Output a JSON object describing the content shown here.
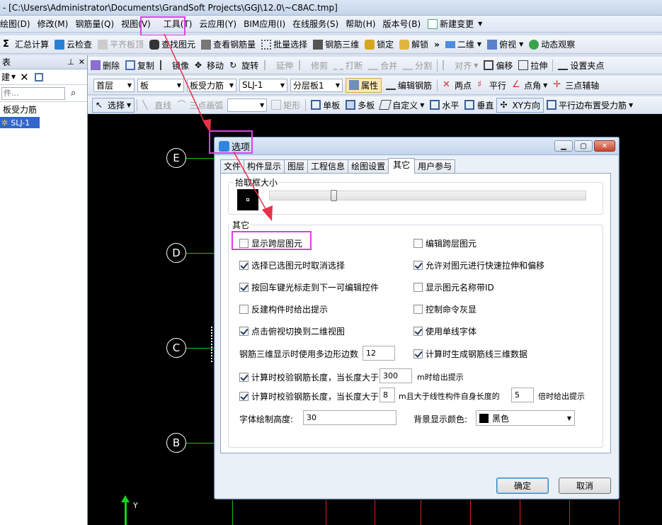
{
  "window": {
    "title": "- [C:\\Users\\Administrator\\Documents\\GrandSoft Projects\\GGJ\\12.0\\~C8AC.tmp]"
  },
  "menu": [
    "绘图(D)",
    "修改(M)",
    "钢筋量(Q)",
    "视图(V)",
    "工具(T)",
    "云应用(Y)",
    "BIM应用(I)",
    "在线服务(S)",
    "帮助(H)",
    "版本号(B)",
    "新建变更"
  ],
  "toolbar1": {
    "items": [
      "汇总计算",
      "云检查",
      "平齐板顶",
      "查找图元",
      "查看钢筋量",
      "批量选择",
      "钢筋三维",
      "锁定",
      "解锁"
    ],
    "view_combo": "二维",
    "view_mode": "俯视",
    "dynamic": "动态观察"
  },
  "toolbar2": {
    "items": [
      "删除",
      "复制",
      "镜像",
      "移动",
      "旋转",
      "延伸",
      "修剪",
      "打断",
      "合并",
      "分割",
      "对齐",
      "偏移",
      "拉伸",
      "设置夹点"
    ]
  },
  "toolbar3": {
    "floor": "首层",
    "category": "板",
    "type": "板受力筋",
    "item": "SLJ-1",
    "layer": "分层板1",
    "props": "属性",
    "edit": "编辑钢筋",
    "pick": [
      "两点",
      "平行",
      "点角",
      "三点辅轴"
    ]
  },
  "toolbar4": {
    "items": [
      "选择",
      "直线",
      "三点画弧",
      "矩形",
      "单板",
      "多板",
      "自定义",
      "水平",
      "垂直",
      "XY方向",
      "平行边布置受力筋"
    ]
  },
  "left_panel": {
    "header": "表",
    "tool": "建",
    "search_placeholder": "件...",
    "tree_parent": "板受力筋",
    "tree_child": "SLJ-1"
  },
  "canvas": {
    "axes": [
      "E",
      "D",
      "C",
      "B"
    ],
    "y_label": "Y"
  },
  "dialog": {
    "title": "选项",
    "tabs": [
      "文件",
      "构件显示",
      "图层",
      "工程信息",
      "绘图设置",
      "其它",
      "用户参与"
    ],
    "active_tab": "其它",
    "pickbox_label": "拾取框大小",
    "other_label": "其它",
    "options": [
      {
        "label": "显示跨层图元",
        "checked": false
      },
      {
        "label": "编辑跨层图元",
        "checked": false
      },
      {
        "label": "选择已选图元时取消选择",
        "checked": true
      },
      {
        "label": "允许对图元进行快速拉伸和偏移",
        "checked": true
      },
      {
        "label": "按回车键光标走到下一可编辑控件",
        "checked": true
      },
      {
        "label": "显示图元名称带ID",
        "checked": false
      },
      {
        "label": "反建构件时给出提示",
        "checked": false
      },
      {
        "label": "控制命令灰显",
        "checked": false
      },
      {
        "label": "点击俯视切换到二维视图",
        "checked": true
      },
      {
        "label": "使用单线字体",
        "checked": true
      }
    ],
    "polygon_label": "钢筋三维显示时使用多边形边数",
    "polygon_value": "12",
    "gen3d_label": "计算时生成钢筋线三维数据",
    "gen3d_checked": true,
    "check1": {
      "pre": "计算时校验钢筋长度，当长度大于",
      "value": "300",
      "post": "m时给出提示",
      "checked": true
    },
    "check2": {
      "pre": "计算时校验钢筋长度，当长度大于",
      "value1": "8",
      "mid": "m且大于线性构件自身长度的",
      "value2": "5",
      "post": "倍时给出提示",
      "checked": true
    },
    "font_height_label": "字体绘制高度:",
    "font_height_value": "30",
    "bg_color_label": "背景显示颜色:",
    "bg_color_value": "黑色",
    "ok": "确定",
    "cancel": "取消"
  },
  "colors": {
    "highlight": "#e23de6",
    "arrow": "#e8304a",
    "axis_line": "#19c219"
  }
}
